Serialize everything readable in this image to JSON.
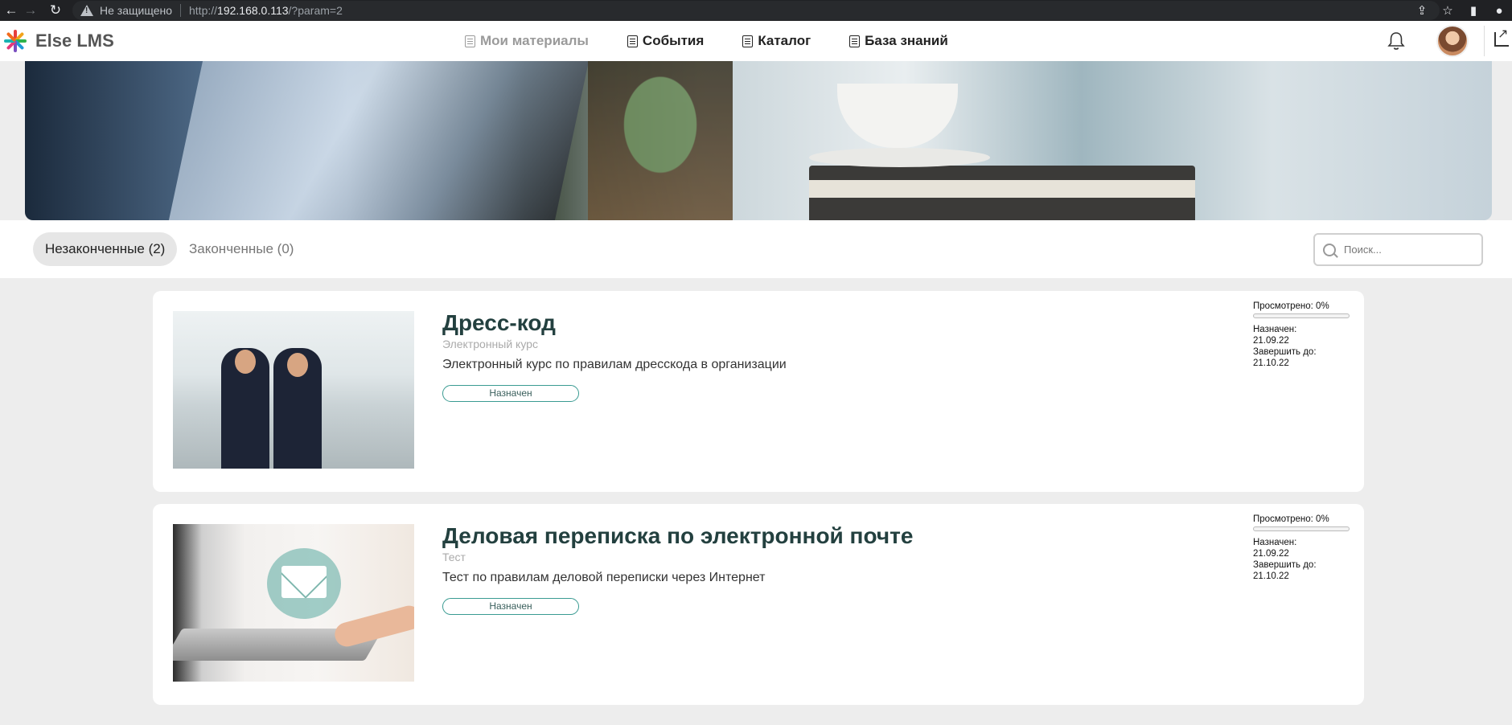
{
  "browser": {
    "insecure_label": "Не защищено",
    "url_prefix": "http://",
    "url_host": "192.168.0.113",
    "url_path": "/?param=2"
  },
  "header": {
    "logo_text": "Else LMS",
    "nav": [
      {
        "label": "Мои материалы",
        "active": true
      },
      {
        "label": "События",
        "active": false
      },
      {
        "label": "Каталог",
        "active": false
      },
      {
        "label": "База знаний",
        "active": false
      }
    ]
  },
  "tabs": [
    {
      "label": "Незаконченные (2)",
      "active": true
    },
    {
      "label": "Законченные (0)",
      "active": false
    }
  ],
  "search": {
    "placeholder": "Поиск..."
  },
  "courses": [
    {
      "title": "Дресс-код",
      "type": "Электронный курс",
      "description": "Электронный курс по правилам дресскода в организации",
      "status": "Назначен",
      "viewed_label": "Просмотрено: 0%",
      "progress": 0,
      "assigned_label": "Назначен:",
      "assigned_date": "21.09.22",
      "due_label": "Завершить до:",
      "due_date": "21.10.22"
    },
    {
      "title": "Деловая переписка по электронной почте",
      "type": "Тест",
      "description": "Тест по правилам деловой переписки через Интернет",
      "status": "Назначен",
      "viewed_label": "Просмотрено: 0%",
      "progress": 0,
      "assigned_label": "Назначен:",
      "assigned_date": "21.09.22",
      "due_label": "Завершить до:",
      "due_date": "21.10.22"
    }
  ],
  "colors": {
    "accent": "#3a9b92",
    "title": "#23403f",
    "background": "#ededed"
  }
}
